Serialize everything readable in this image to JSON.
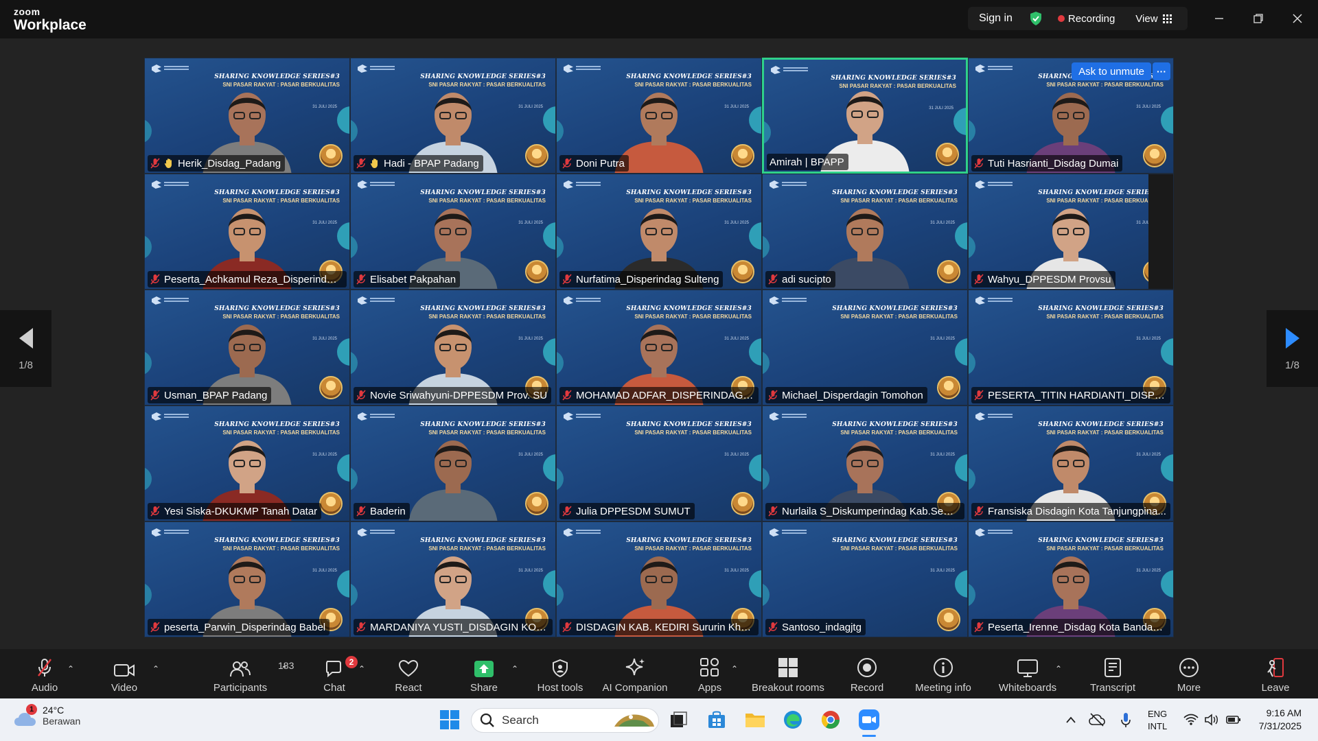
{
  "app": {
    "logo_top": "zoom",
    "logo_bottom": "Workplace"
  },
  "topbar": {
    "sign_in": "Sign in",
    "recording": "Recording",
    "view": "View"
  },
  "colors": {
    "accent": "#1f6fe5",
    "active_speaker": "#2fd18a",
    "record": "#e0393e",
    "tile_bg": "#1b427a"
  },
  "banner": {
    "line1": "SHARING KNOWLEDGE SERIES#3",
    "line2": "SNI PASAR RAKYAT : PASAR BERKUALITAS",
    "date": "31 JULI 2025"
  },
  "gallery": {
    "ask_unmute": "Ask to unmute",
    "ask_more": "···",
    "tiles": [
      {
        "name": "Herik_Disdag_Padang",
        "hand": true,
        "person": true
      },
      {
        "name": "Hadi - BPAP Padang",
        "hand": true,
        "person": true
      },
      {
        "name": "Doni Putra",
        "hand": false,
        "person": true
      },
      {
        "name": "Amirah | BPAPP",
        "hand": false,
        "person": true,
        "active": true,
        "nomic": true
      },
      {
        "name": "Tuti Hasrianti_Disdag Dumai",
        "hand": false,
        "person": true,
        "unmute": true
      },
      {
        "name": "Peserta_Achkamul Reza_Disperindag ...",
        "hand": false,
        "person": true
      },
      {
        "name": "Elisabet Pakpahan",
        "hand": false,
        "person": true
      },
      {
        "name": "Nurfatima_Disperindag Sulteng",
        "hand": false,
        "person": true
      },
      {
        "name": "adi sucipto",
        "hand": false,
        "person": true
      },
      {
        "name": "Wahyu_DPPESDM Provsu",
        "hand": false,
        "person": true,
        "darkedge": true
      },
      {
        "name": "Usman_BPAP Padang",
        "hand": false,
        "person": true
      },
      {
        "name": "Novie Sriwahyuni-DPPESDM Prov. SU",
        "hand": false,
        "person": true
      },
      {
        "name": "MOHAMAD ADFAR_DISPERINDAG S...",
        "hand": false,
        "person": true
      },
      {
        "name": "Michael_Disperdagin Tomohon",
        "hand": false,
        "person": false
      },
      {
        "name": "PESERTA_TITIN HARDIANTI_DISPERD...",
        "hand": false,
        "person": false
      },
      {
        "name": "Yesi Siska-DKUKMP Tanah Datar",
        "hand": false,
        "person": true
      },
      {
        "name": "Baderin",
        "hand": false,
        "person": true
      },
      {
        "name": "Julia DPPESDM SUMUT",
        "hand": false,
        "person": false
      },
      {
        "name": "Nurlaila S_Diskumperindag Kab.Sem...",
        "hand": false,
        "person": true
      },
      {
        "name": "Fransiska Disdagin Kota Tanjungpina...",
        "hand": false,
        "person": true
      },
      {
        "name": "peserta_Parwin_Disperindag Babel",
        "hand": false,
        "person": true
      },
      {
        "name": "MARDANIYA YUSTI_DISDAGIN KOTA ...",
        "hand": false,
        "person": true
      },
      {
        "name": "DISDAGIN KAB. KEDIRI Sururin Kharir...",
        "hand": false,
        "person": true
      },
      {
        "name": "Santoso_indagjtg",
        "hand": false,
        "person": false
      },
      {
        "name": "Peserta_Irenne_Disdag Kota Bandar L...",
        "hand": false,
        "person": true
      }
    ]
  },
  "pager": {
    "left": "1/8",
    "right": "1/8"
  },
  "toolbar": {
    "audio": "Audio",
    "video": "Video",
    "participants": "Participants",
    "participants_count": "183",
    "chat": "Chat",
    "chat_badge": "2",
    "react": "React",
    "share": "Share",
    "host_tools": "Host tools",
    "ai_companion": "AI Companion",
    "apps": "Apps",
    "breakout_rooms": "Breakout rooms",
    "record": "Record",
    "meeting_info": "Meeting info",
    "whiteboards": "Whiteboards",
    "transcript": "Transcript",
    "more": "More",
    "leave": "Leave"
  },
  "taskbar": {
    "weather_badge": "1",
    "temperature": "24°C",
    "weather_desc": "Berawan",
    "search": "Search",
    "lang1": "ENG",
    "lang2": "INTL",
    "time": "9:16 AM",
    "date": "7/31/2025"
  }
}
